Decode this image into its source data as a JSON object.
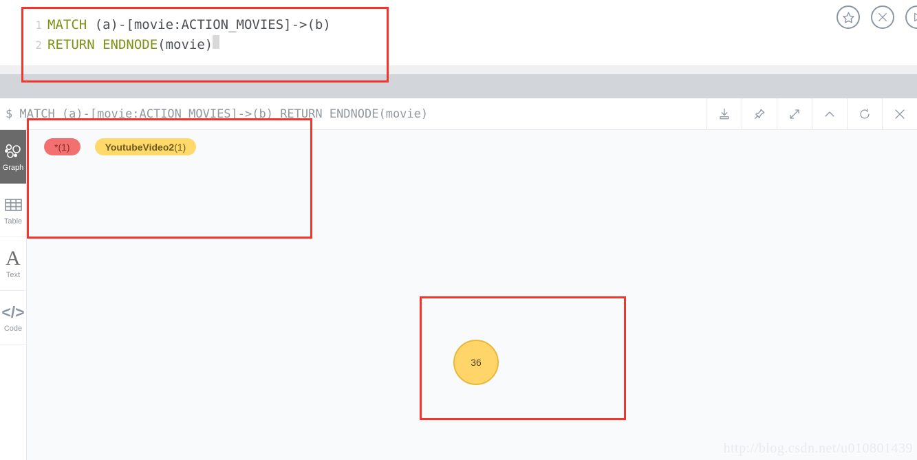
{
  "editor": {
    "lines": [
      {
        "number": "1",
        "tokens": [
          {
            "t": "MATCH",
            "c": "kw"
          },
          {
            "t": " (a)-[movie:ACTION_MOVIES]->(b)",
            "c": "pl"
          }
        ]
      },
      {
        "number": "2",
        "tokens": [
          {
            "t": "RETURN ENDNODE",
            "c": "kw"
          },
          {
            "t": "(movie)",
            "c": "pl"
          }
        ]
      }
    ],
    "line1_number": "1",
    "line1_keyword": "MATCH",
    "line1_rest": " (a)-[movie:ACTION_MOVIES]->(b)",
    "line2_number": "2",
    "line2_keyword": "RETURN ENDNODE",
    "line2_rest": "(movie)",
    "actions": [
      {
        "name": "favorite-button",
        "icon": "star-icon",
        "title": "Favorite"
      },
      {
        "name": "clear-button",
        "icon": "close-circle-icon",
        "title": "Clear"
      },
      {
        "name": "run-button",
        "icon": "play-circle-icon",
        "title": "Run"
      }
    ]
  },
  "result": {
    "prompt": "$",
    "query": "MATCH (a)-[movie:ACTION_MOVIES]->(b) RETURN ENDNODE(movie)",
    "tools": [
      {
        "name": "download-button",
        "icon": "download-icon"
      },
      {
        "name": "pin-button",
        "icon": "pin-icon"
      },
      {
        "name": "expand-button",
        "icon": "expand-icon"
      },
      {
        "name": "collapse-button",
        "icon": "chevron-up-icon"
      },
      {
        "name": "refresh-button",
        "icon": "refresh-icon"
      },
      {
        "name": "close-button",
        "icon": "close-icon"
      }
    ]
  },
  "view_sidebar": {
    "items": [
      {
        "label": "Graph",
        "icon": "graph-icon",
        "active": true
      },
      {
        "label": "Table",
        "icon": "table-icon",
        "active": false
      },
      {
        "label": "Text",
        "icon": "text-icon",
        "active": false
      },
      {
        "label": "Code",
        "icon": "code-icon",
        "active": false
      }
    ]
  },
  "legend": {
    "relationship": {
      "main": "*",
      "count": "(1)",
      "color": "#f2706f"
    },
    "node": {
      "main": "YoutubeVideo2",
      "count": "(1)",
      "color": "#ffd96a"
    }
  },
  "graph": {
    "nodes": [
      {
        "label": "36",
        "fill": "#ffd469",
        "stroke": "#eab83c"
      }
    ]
  },
  "watermark": {
    "text": "http://blog.csdn.net/u010801439"
  },
  "annotations": {
    "accent": "#f5342b",
    "boxes": [
      "editor-query",
      "result-legend",
      "graph-node"
    ]
  }
}
